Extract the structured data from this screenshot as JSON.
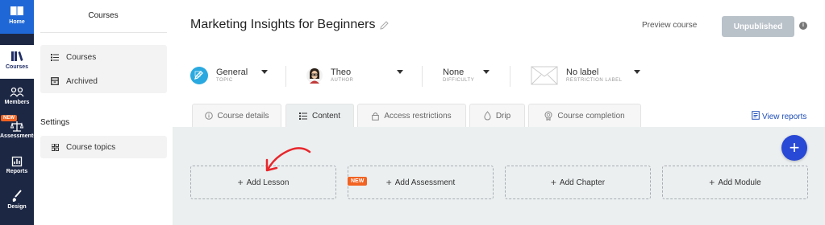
{
  "rail": {
    "home": "Home",
    "courses": "Courses",
    "members": "Members",
    "new_badge": "NEW",
    "assessments": "Assessments",
    "reports": "Reports",
    "design": "Design"
  },
  "sidebar": {
    "title": "Courses",
    "items": [
      {
        "label": "Courses",
        "icon": "list-icon"
      },
      {
        "label": "Archived",
        "icon": "archive-icon"
      }
    ],
    "settings_heading": "Settings",
    "course_topics": "Course topics"
  },
  "header": {
    "title": "Marketing Insights for Beginners",
    "preview": "Preview course",
    "status_button": "Unpublished"
  },
  "meta": {
    "topic": {
      "value": "General",
      "label": "TOPIC"
    },
    "author": {
      "value": "Theo",
      "label": "AUTHOR"
    },
    "difficulty": {
      "value": "None",
      "label": "DIFFICULTY"
    },
    "restriction": {
      "value": "No label",
      "label": "RESTRICTION LABEL"
    }
  },
  "tabs": [
    {
      "label": "Course details",
      "icon": "info-icon"
    },
    {
      "label": "Content",
      "icon": "list-icon",
      "active": true
    },
    {
      "label": "Access restrictions",
      "icon": "lock-icon"
    },
    {
      "label": "Drip",
      "icon": "drop-icon"
    },
    {
      "label": "Course completion",
      "icon": "medal-icon"
    }
  ],
  "view_reports": "View reports",
  "content": {
    "add_lesson": "Add Lesson",
    "add_assessment": "Add Assessment",
    "assessment_badge": "NEW",
    "add_chapter": "Add Chapter",
    "add_module": "Add Module"
  },
  "colors": {
    "rail": "#1c2744",
    "home_active": "#1f67d6",
    "accent": "#2848d6",
    "badge": "#f26322",
    "annotation_arrow": "#e8262b",
    "topic_icon": "#29a9e0"
  }
}
